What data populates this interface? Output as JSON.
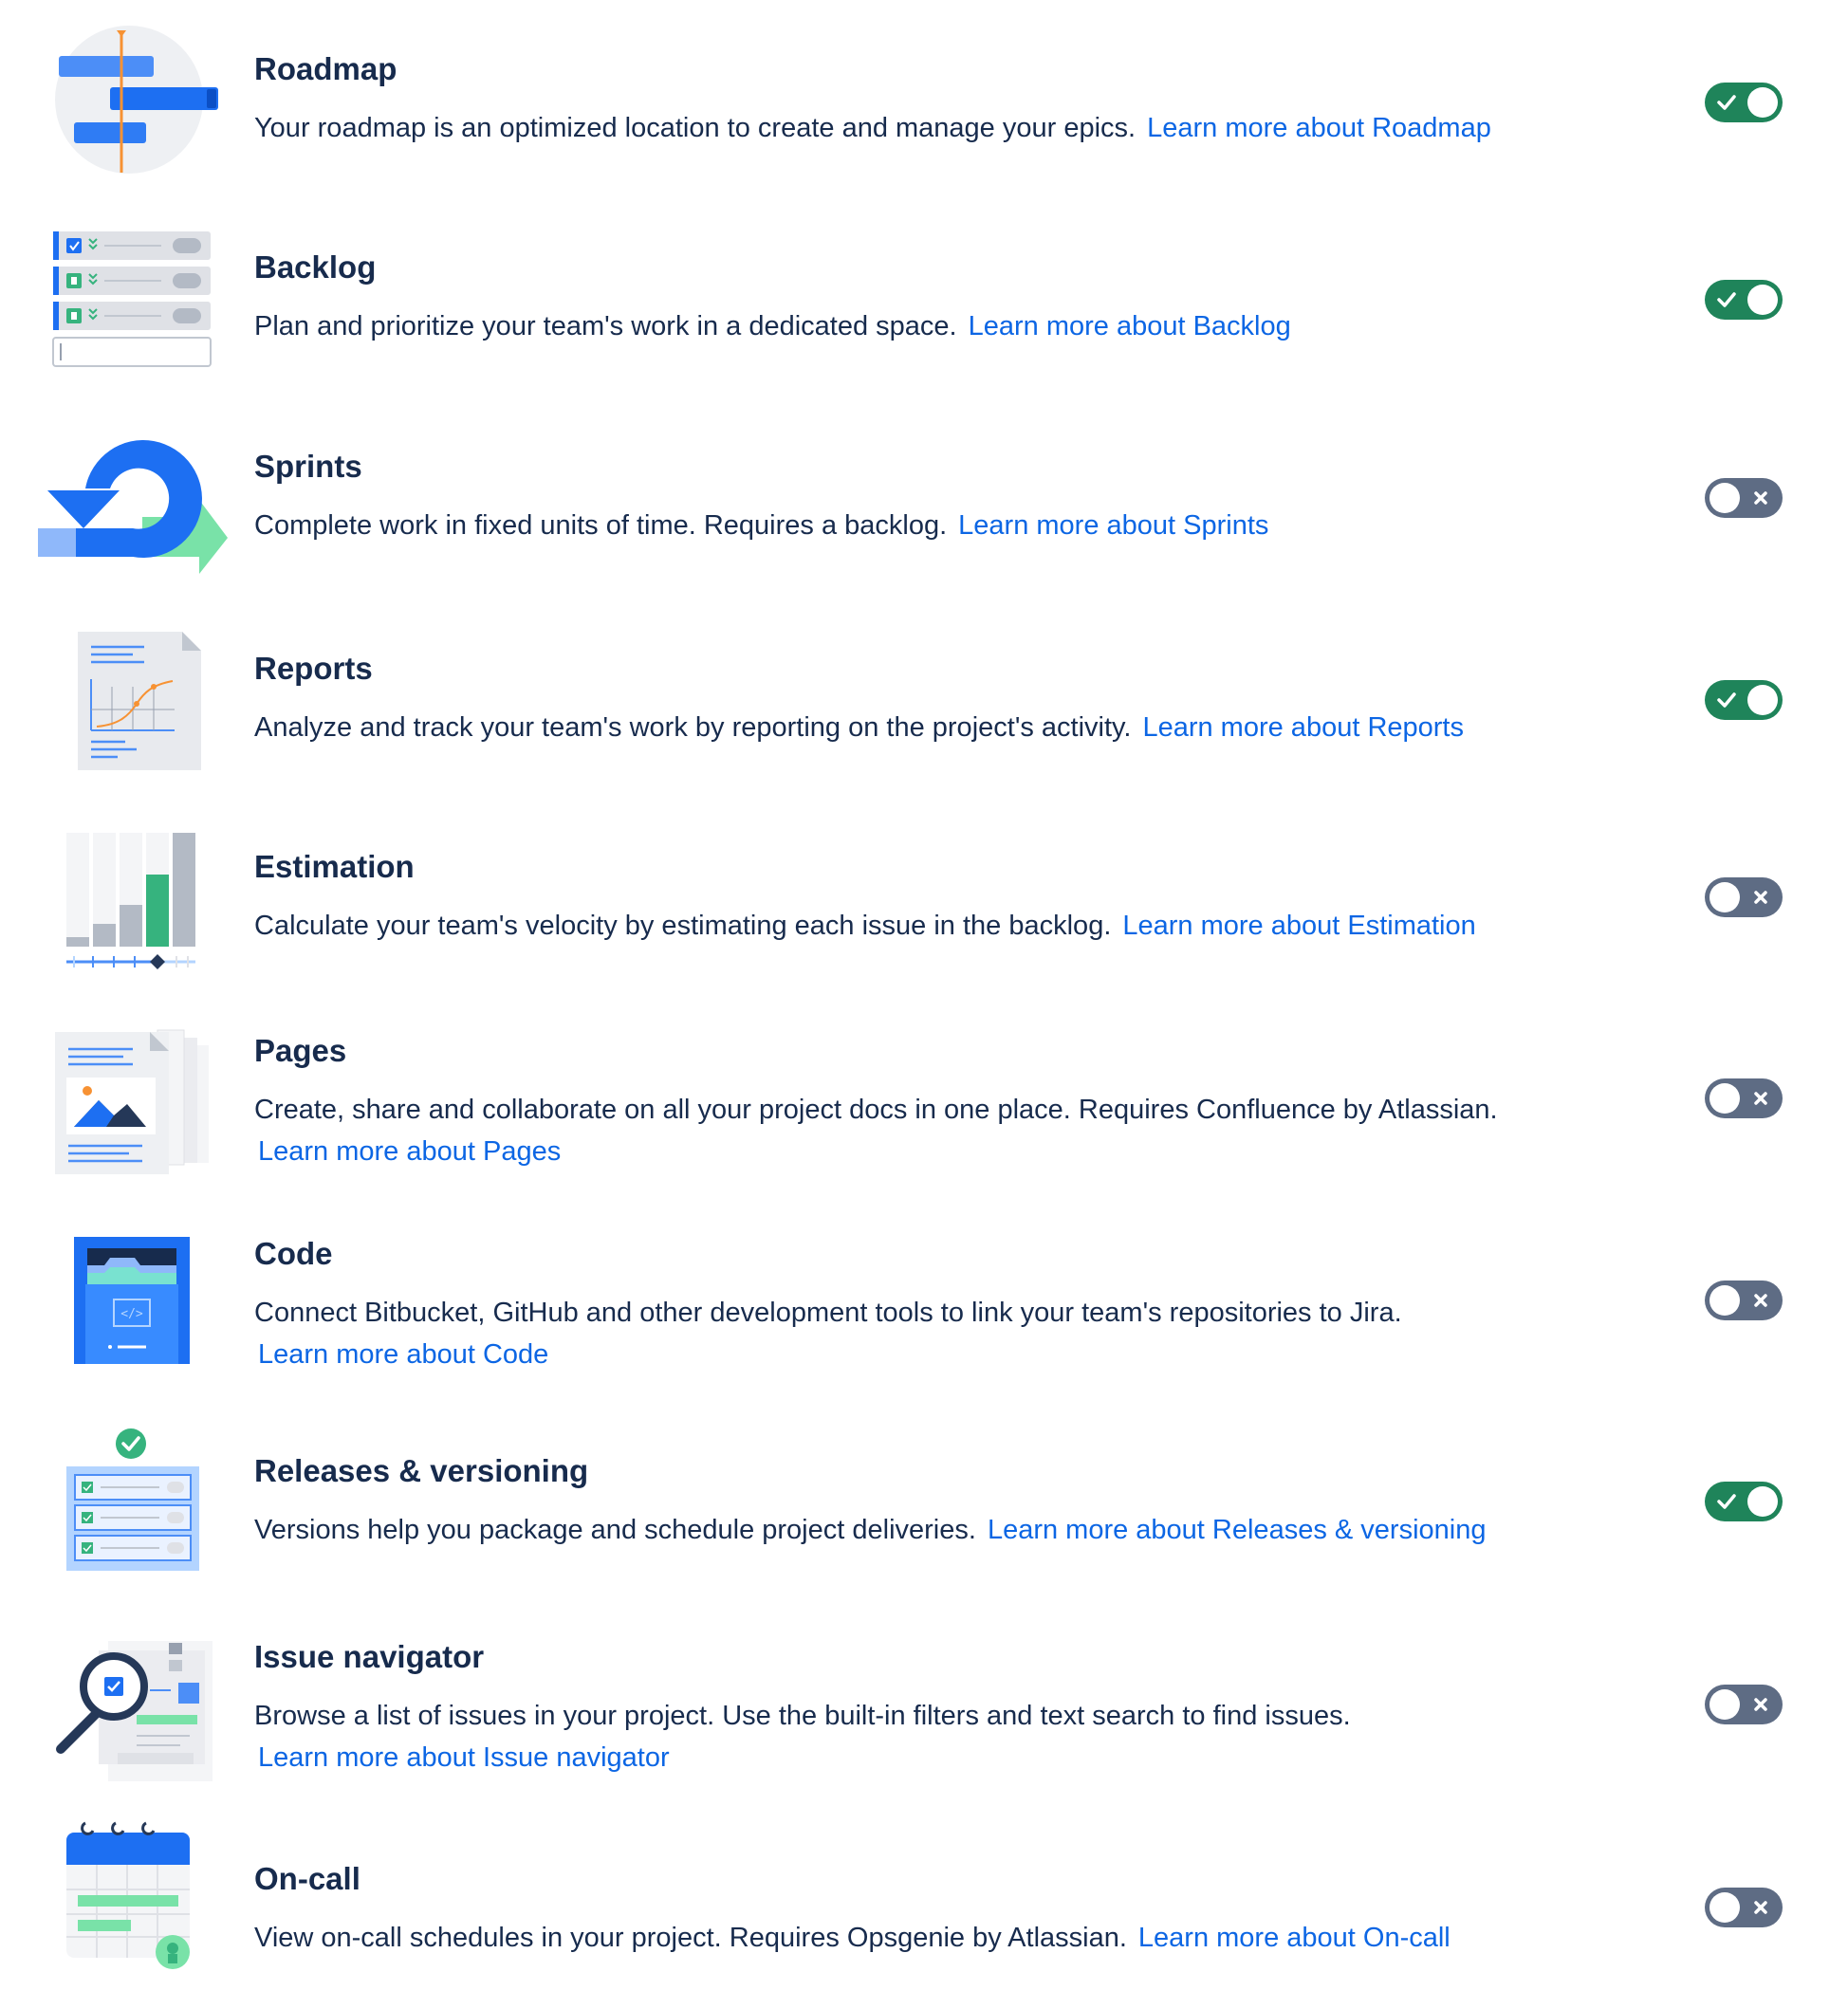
{
  "features": [
    {
      "id": "roadmap",
      "title": "Roadmap",
      "description": "Your roadmap is an optimized location to create and manage your epics.",
      "link": "Learn more about Roadmap",
      "enabled": true,
      "icon": "roadmap-illustration"
    },
    {
      "id": "backlog",
      "title": "Backlog",
      "description": "Plan and prioritize your team's work in a dedicated space.",
      "link": "Learn more about Backlog",
      "enabled": true,
      "icon": "backlog-illustration"
    },
    {
      "id": "sprints",
      "title": "Sprints",
      "description": "Complete work in fixed units of time. Requires a backlog.",
      "link": "Learn more about Sprints",
      "enabled": false,
      "icon": "sprints-illustration"
    },
    {
      "id": "reports",
      "title": "Reports",
      "description": "Analyze and track your team's work by reporting on the project's activity.",
      "link": "Learn more about Reports",
      "enabled": true,
      "icon": "reports-illustration"
    },
    {
      "id": "estimation",
      "title": "Estimation",
      "description": "Calculate your team's velocity by estimating each issue in the backlog.",
      "link": "Learn more about Estimation",
      "enabled": false,
      "icon": "estimation-illustration"
    },
    {
      "id": "pages",
      "title": "Pages",
      "description": "Create, share and collaborate on all your project docs in one place. Requires Confluence by Atlassian.",
      "link": "Learn more about Pages",
      "enabled": false,
      "icon": "pages-illustration"
    },
    {
      "id": "code",
      "title": "Code",
      "description": "Connect Bitbucket, GitHub and other development tools to link your team's repositories to Jira.",
      "link": "Learn more about Code",
      "enabled": false,
      "icon": "code-illustration"
    },
    {
      "id": "releases",
      "title": "Releases & versioning",
      "description": "Versions help you package and schedule project deliveries.",
      "link": "Learn more about Releases & versioning",
      "enabled": true,
      "icon": "releases-illustration"
    },
    {
      "id": "issue-navigator",
      "title": "Issue navigator",
      "description": "Browse a list of issues in your project. Use the built-in filters and text search to find issues.",
      "link": "Learn more about Issue navigator",
      "enabled": false,
      "icon": "issue-navigator-illustration"
    },
    {
      "id": "on-call",
      "title": "On-call",
      "description": "View on-call schedules in your project. Requires Opsgenie by Atlassian.",
      "link": "Learn more about On-call",
      "enabled": false,
      "icon": "on-call-illustration"
    }
  ],
  "colors": {
    "toggle_on": "#1f845a",
    "toggle_off": "#5e6c84",
    "link": "#0c66e4",
    "text": "#172b4d"
  }
}
